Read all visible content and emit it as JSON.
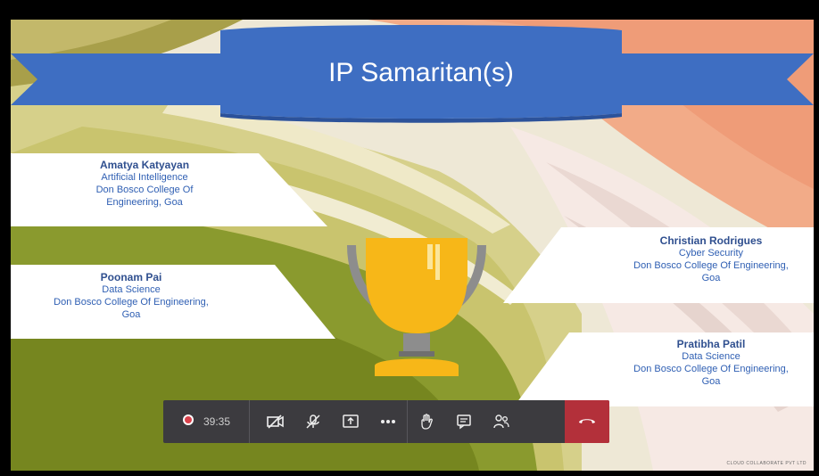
{
  "slide": {
    "title": "IP Samaritan(s)",
    "cards": [
      {
        "name": "Amatya Katyayan",
        "line1": "Artificial Intelligence",
        "line2": "Don Bosco College Of",
        "line3": "Engineering,  Goa"
      },
      {
        "name": "Poonam Pai",
        "line1": "Data Science",
        "line2": "Don Bosco College Of Engineering,",
        "line3": "Goa"
      },
      {
        "name": "Christian Rodrigues",
        "line1": "Cyber Security",
        "line2": "Don Bosco College Of Engineering,",
        "line3": "Goa"
      },
      {
        "name": "Pratibha Patil",
        "line1": "Data Science",
        "line2": "Don Bosco College Of Engineering,",
        "line3": "Goa"
      }
    ],
    "footer_brand": "CLOUD COLLABORATE PVT LTD"
  },
  "toolbar": {
    "recording_time": "39:35",
    "icons": [
      "record-icon",
      "camera-off-icon",
      "mic-off-icon",
      "share-screen-icon",
      "more-icon",
      "raise-hand-icon",
      "chat-icon",
      "participants-icon",
      "hang-up-icon"
    ]
  },
  "colors": {
    "banner": "#3e6ec2",
    "banner_dark": "#2c529a",
    "green": "#7f8e2a",
    "orange": "#f0a080",
    "trophy": "#f7b718",
    "toolbar_bg": "#3c3b3f",
    "hangup": "#b3303a"
  }
}
